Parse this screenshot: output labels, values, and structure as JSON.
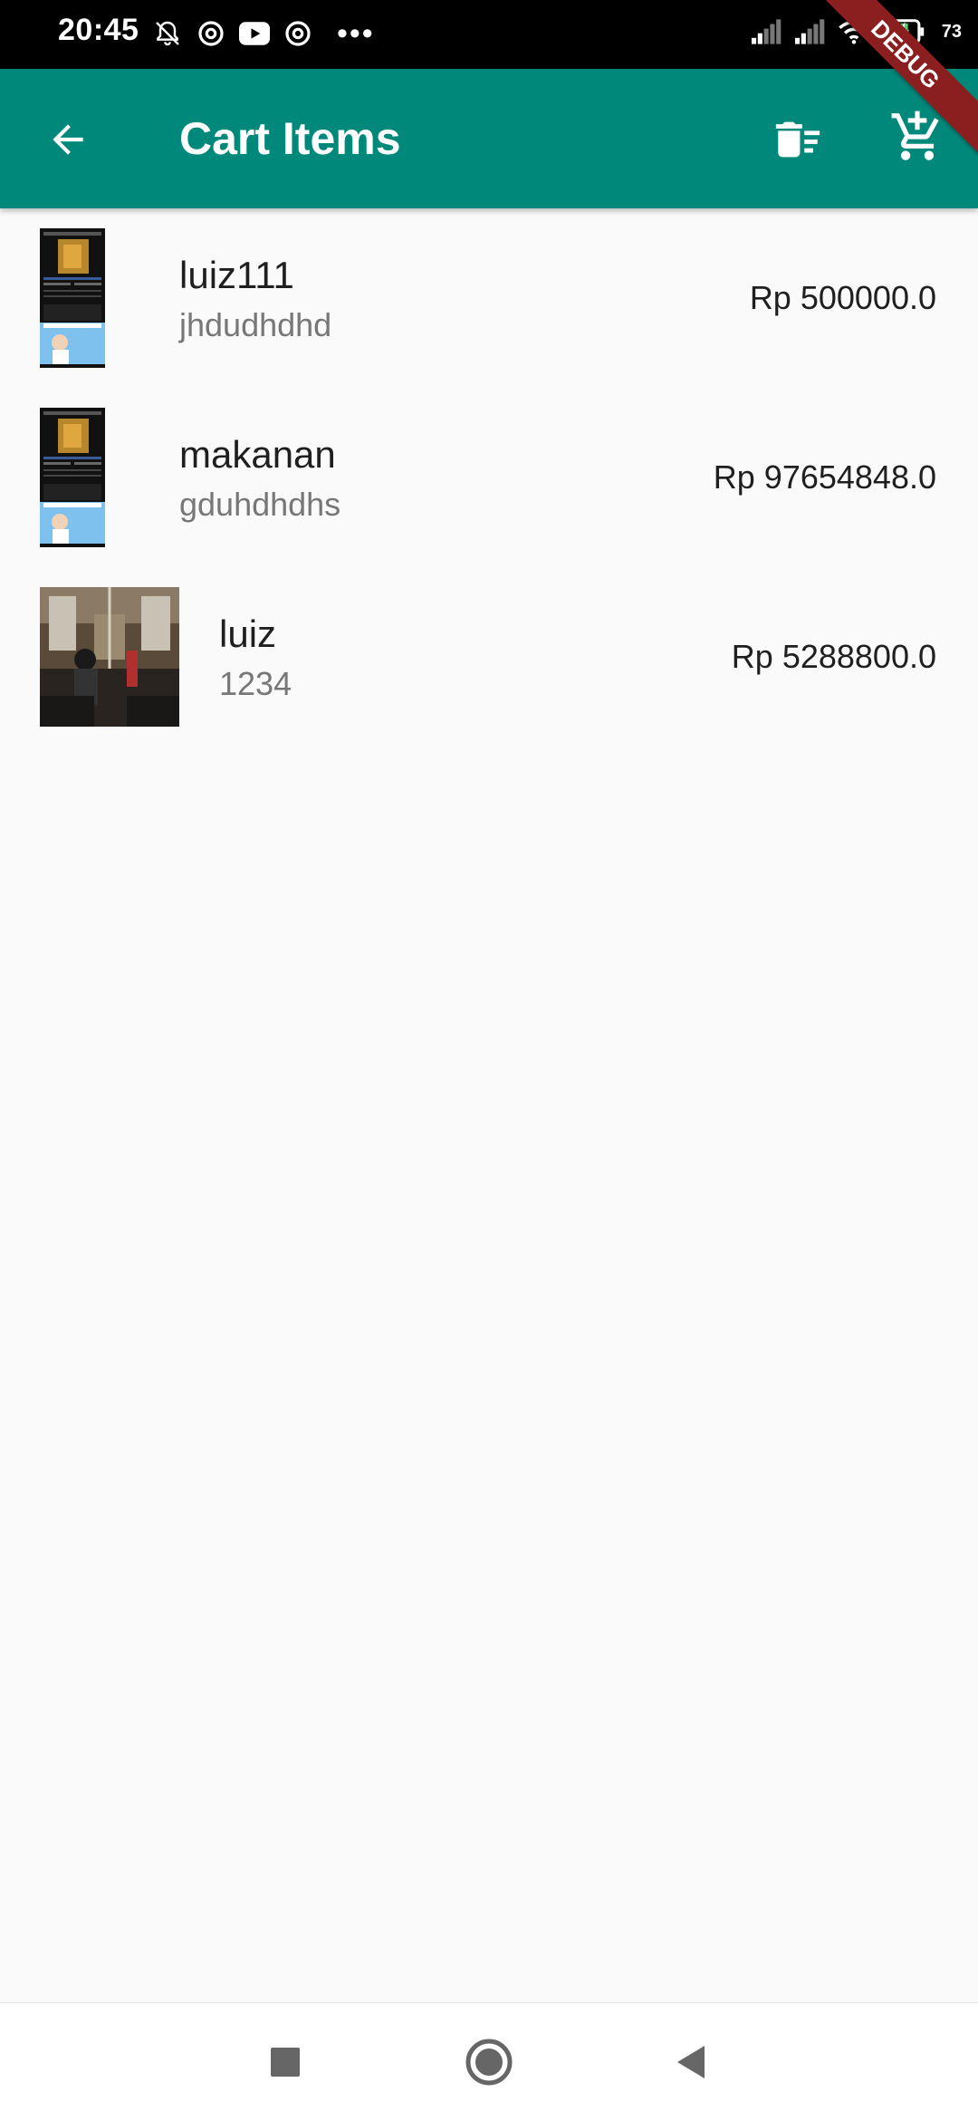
{
  "status_bar": {
    "time": "20:45",
    "battery": "73"
  },
  "debug_banner": "DEBUG",
  "app_bar": {
    "title": "Cart Items"
  },
  "items": [
    {
      "title": "luiz111",
      "subtitle": "jhdudhdhd",
      "price": "Rp 500000.0",
      "thumb": "poster"
    },
    {
      "title": "makanan",
      "subtitle": "gduhdhdhs",
      "price": "Rp 97654848.0",
      "thumb": "poster"
    },
    {
      "title": "luiz",
      "subtitle": "1234",
      "price": "Rp 5288800.0",
      "thumb": "photo"
    }
  ],
  "colors": {
    "primary": "#00897b",
    "background": "#fafafa"
  }
}
